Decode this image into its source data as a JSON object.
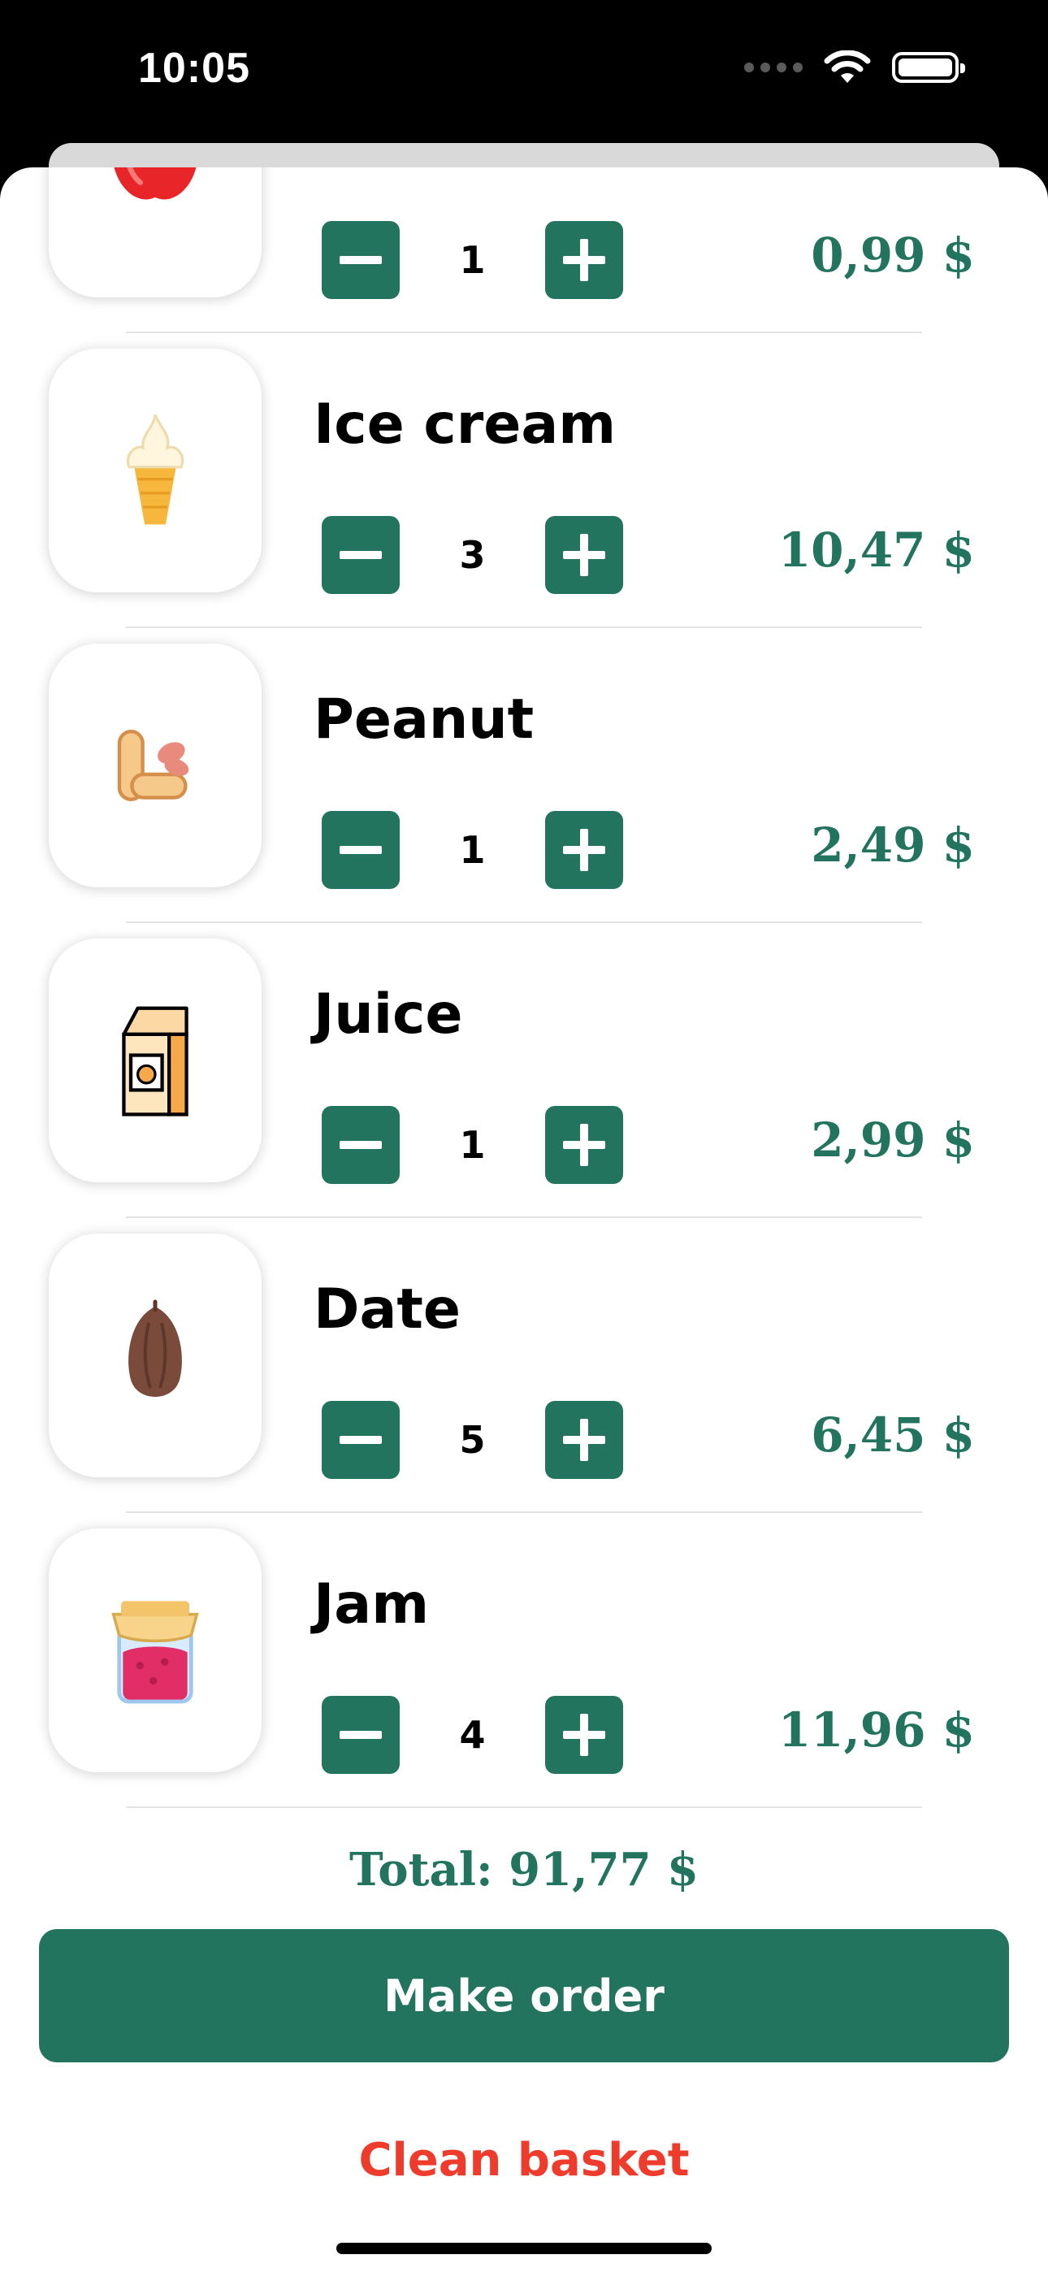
{
  "status_bar": {
    "time": "10:05",
    "icons": [
      "dots-icon",
      "wifi-icon",
      "battery-icon"
    ]
  },
  "basket": {
    "items": [
      {
        "name": "",
        "icon": "apple-icon",
        "quantity": "1",
        "price": "0,99 $"
      },
      {
        "name": "Ice cream",
        "icon": "ice-cream-icon",
        "quantity": "3",
        "price": "10,47 $"
      },
      {
        "name": "Peanut",
        "icon": "peanut-icon",
        "quantity": "1",
        "price": "2,49 $"
      },
      {
        "name": "Juice",
        "icon": "juice-box-icon",
        "quantity": "1",
        "price": "2,99 $"
      },
      {
        "name": "Date",
        "icon": "date-fruit-icon",
        "quantity": "5",
        "price": "6,45 $"
      },
      {
        "name": "Jam",
        "icon": "jam-jar-icon",
        "quantity": "4",
        "price": "11,96 $"
      }
    ],
    "total_label": "Total: 91,77 $",
    "make_order_label": "Make order",
    "clean_basket_label": "Clean basket"
  },
  "colors": {
    "accent": "#23745e",
    "danger": "#ee3b2b"
  }
}
